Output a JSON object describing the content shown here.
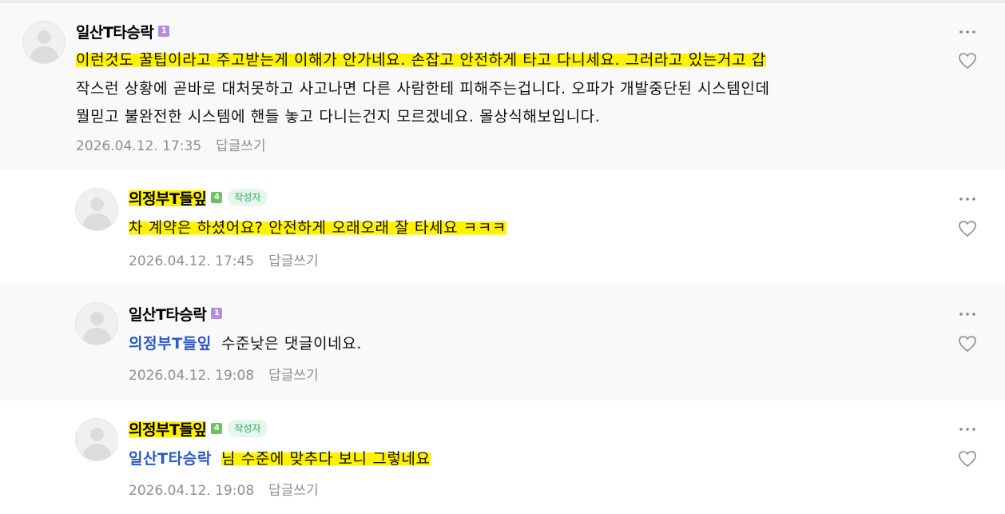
{
  "comments": [
    {
      "author": "일산T타승락",
      "level": "1",
      "lines": [
        "이런것도 꿀팁이라고 주고받는게 이해가 안가네요. 손잡고 안전하게 타고 다니세요. 그러라고 있는거고 갑",
        "작스런 상황에 곧바로 대처못하고 사고나면 다른 사람한테 피해주는겁니다. 오파가 개발중단된 시스템인데",
        "뭘믿고 불완전한 시스템에 핸들 놓고 다니는건지 모르겠네요. 몰상식해보입니다."
      ],
      "date": "2026.04.12. 17:35",
      "reply_label": "답글쓰기"
    },
    {
      "author": "의정부T들잎",
      "level": "4",
      "badge": "작성자",
      "text": "차 계약은 하셨어요? 안전하게 오래오래 잘 타세요 ㅋㅋㅋ",
      "date": "2026.04.12. 17:45",
      "reply_label": "답글쓰기"
    },
    {
      "author": "일산T타승락",
      "level": "1",
      "mention": "의정부T들잎",
      "text": "수준낮은 댓글이네요.",
      "date": "2026.04.12. 19:08",
      "reply_label": "답글쓰기"
    },
    {
      "author": "의정부T들잎",
      "level": "4",
      "badge": "작성자",
      "mention": "일산T타승락",
      "text": "님 수준에 맞추다 보니 그렇네요",
      "date": "2026.04.12. 19:08",
      "reply_label": "답글쓰기"
    }
  ],
  "colors": {
    "highlight": "#fff200",
    "mention": "#2c59c6",
    "meta": "#8f8f8f",
    "level_purple": "#b78be0",
    "level_green": "#6cc25e",
    "badge_bg": "#e6f6ec",
    "badge_text": "#3aa763"
  },
  "icons": {
    "more": "more-dots-icon",
    "like": "heart-outline-icon",
    "avatar": "default-avatar-icon"
  }
}
